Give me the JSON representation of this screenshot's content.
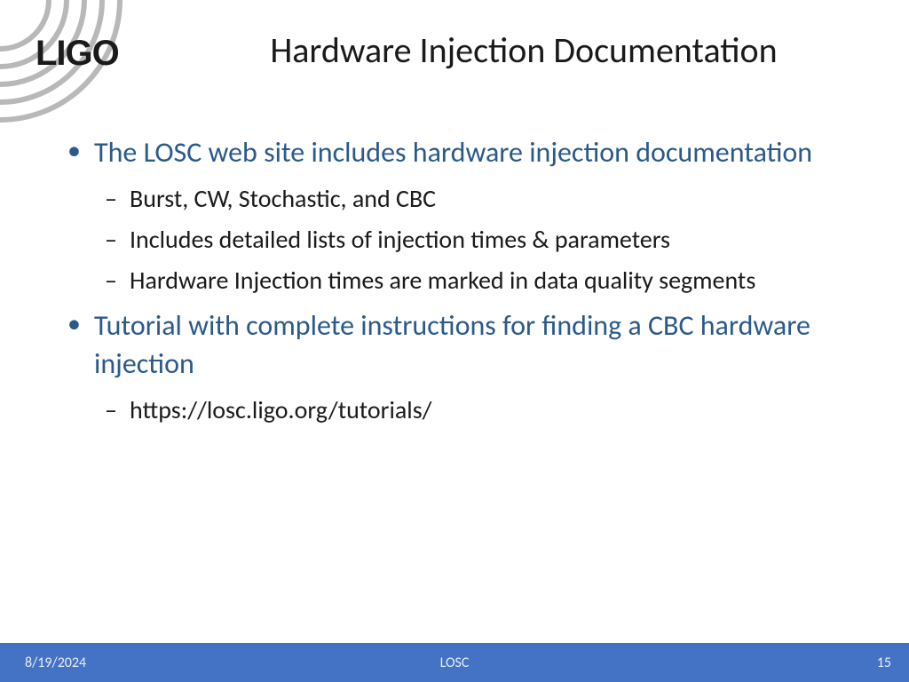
{
  "logo_text": "LIGO",
  "title": "Hardware Injection Documentation",
  "bullets": [
    {
      "text": "The LOSC web site includes hardware injection documentation",
      "sub": [
        "Burst, CW, Stochastic, and CBC",
        "Includes detailed lists of injection times & parameters",
        "Hardware Injection times are marked in data quality segments"
      ]
    },
    {
      "text": "Tutorial with complete instructions for finding a CBC hardware injection",
      "sub": [
        "https://losc.ligo.org/tutorials/"
      ]
    }
  ],
  "footer": {
    "date": "8/19/2024",
    "center": "LOSC",
    "page": "15"
  }
}
